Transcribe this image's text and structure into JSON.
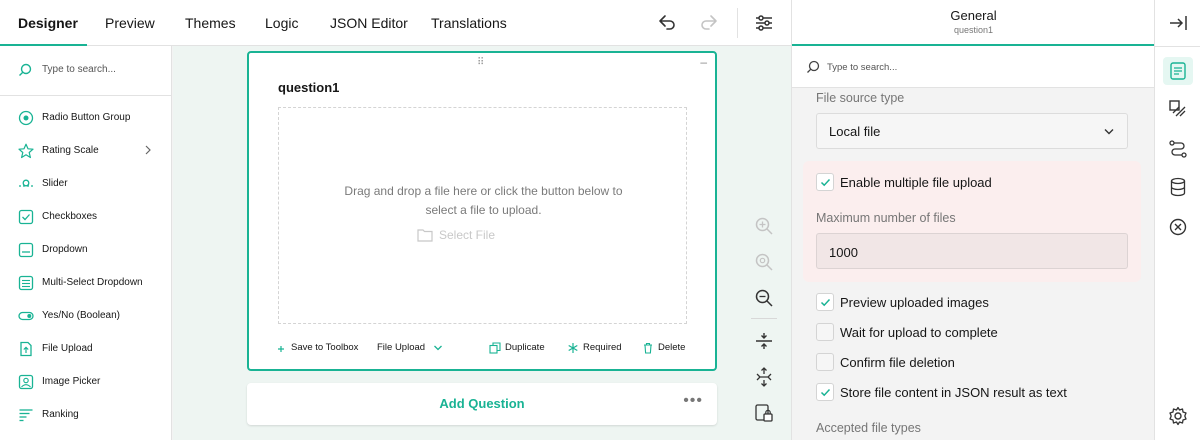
{
  "tabs": [
    {
      "label": "Designer",
      "active": true
    },
    {
      "label": "Preview"
    },
    {
      "label": "Themes"
    },
    {
      "label": "Logic"
    },
    {
      "label": "JSON Editor"
    },
    {
      "label": "Translations"
    }
  ],
  "toolbar_icons": [
    "undo-icon",
    "redo-icon",
    "settings-sliders-icon"
  ],
  "toolbox": {
    "search_placeholder": "Type to search...",
    "items": [
      {
        "label": "Radio Button Group",
        "icon": "radio-icon"
      },
      {
        "label": "Rating Scale",
        "icon": "star-icon",
        "has_submenu": true
      },
      {
        "label": "Slider",
        "icon": "slider-icon"
      },
      {
        "label": "Checkboxes",
        "icon": "checkbox-icon"
      },
      {
        "label": "Dropdown",
        "icon": "dropdown-icon"
      },
      {
        "label": "Multi-Select Dropdown",
        "icon": "multiselect-icon"
      },
      {
        "label": "Yes/No (Boolean)",
        "icon": "toggle-icon"
      },
      {
        "label": "File Upload",
        "icon": "file-upload-icon"
      },
      {
        "label": "Image Picker",
        "icon": "image-picker-icon"
      },
      {
        "label": "Ranking",
        "icon": "ranking-icon"
      }
    ]
  },
  "question": {
    "title": "question1",
    "drop_text_line1": "Drag and drop a file here or click the button below to",
    "drop_text_line2": "select a file to upload.",
    "select_file": "Select File",
    "footer": {
      "save_to_toolbox": "Save to Toolbox",
      "type": "File Upload",
      "duplicate": "Duplicate",
      "required": "Required",
      "delete": "Delete"
    }
  },
  "add_question": "Add Question",
  "properties": {
    "title": "General",
    "subtitle": "question1",
    "search_placeholder": "Type to search...",
    "file_source_type_label": "File source type",
    "file_source_type_value": "Local file",
    "enable_multiple_label": "Enable multiple file upload",
    "enable_multiple_checked": true,
    "max_files_label": "Maximum number of files",
    "max_files_value": "1000",
    "checkboxes": [
      {
        "label": "Preview uploaded images",
        "checked": true
      },
      {
        "label": "Wait for upload to complete",
        "checked": false
      },
      {
        "label": "Confirm file deletion",
        "checked": false
      },
      {
        "label": "Store file content in JSON result as text",
        "checked": true
      }
    ],
    "accepted_types_label": "Accepted file types"
  },
  "colors": {
    "accent": "#19b394",
    "highlight": "#fbeeee"
  }
}
